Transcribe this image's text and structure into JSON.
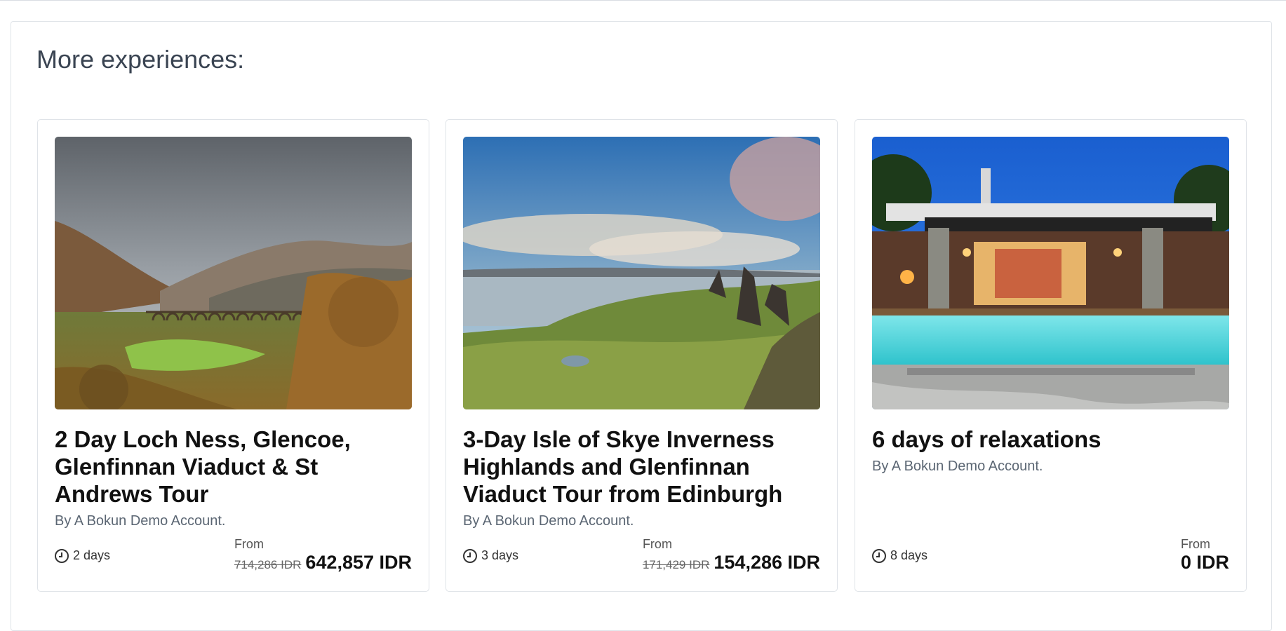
{
  "section": {
    "title": "More experiences:"
  },
  "cards": [
    {
      "image": "Glenfinnan viaduct in autumn highland valley",
      "title": "2 Day Loch Ness, Glencoe, Glenfinnan Viaduct & St Andrews Tour",
      "supplier": "By A Bokun Demo Account.",
      "duration": "2 days",
      "price_label": "From",
      "old_price": "714,286 IDR",
      "price": "642,857 IDR"
    },
    {
      "image": "Old Man of Storr rock pinnacles over a loch, Isle of Skye",
      "title": "3-Day Isle of Skye Inverness Highlands and Glenfinnan Viaduct Tour from Edinburgh",
      "supplier": "By A Bokun Demo Account.",
      "duration": "3 days",
      "price_label": "From",
      "old_price": "171,429 IDR",
      "price": "154,286 IDR"
    },
    {
      "image": "Villa terrace with stone columns and turquoise pool at dusk",
      "title": "6 days of relaxations",
      "supplier": "By A Bokun Demo Account.",
      "duration": "8 days",
      "price_label": "From",
      "old_price": "",
      "price": "0 IDR"
    }
  ],
  "icons": {
    "duration": "clock-icon"
  },
  "colors": {
    "title": "#3a4452",
    "muted": "#5b6673",
    "border": "#dfe3e8"
  }
}
